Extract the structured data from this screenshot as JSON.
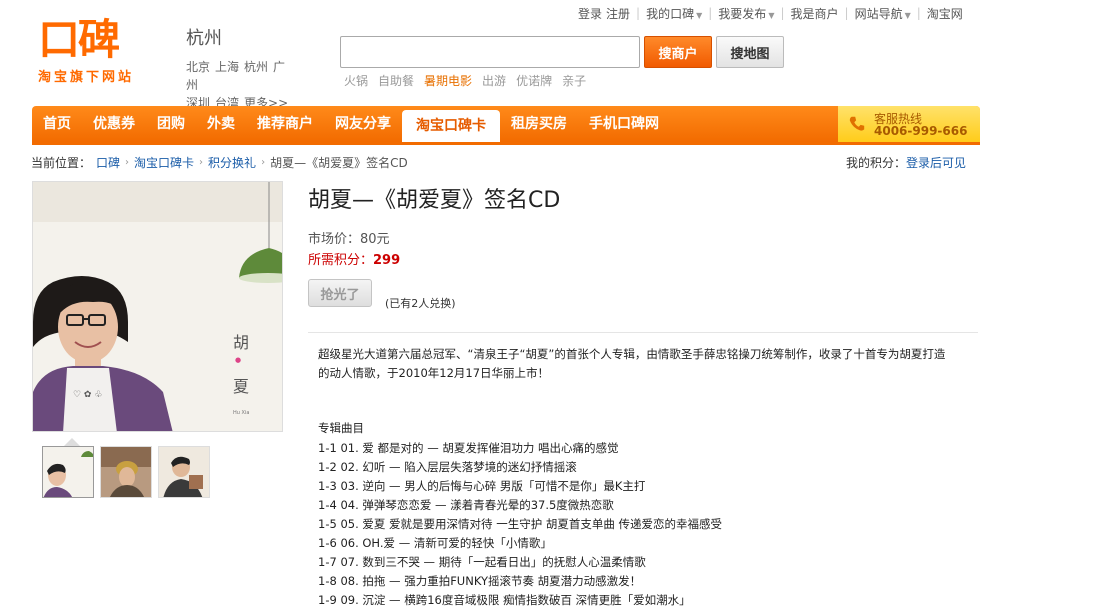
{
  "topbar": {
    "login": "登录",
    "register": "注册",
    "my_koubei": "我的口碑",
    "publish": "我要发布",
    "merchant": "我是商户",
    "site_nav": "网站导航",
    "taobao": "淘宝网"
  },
  "logo": {
    "main": "口碑",
    "sub": "淘宝旗下网站"
  },
  "city": {
    "current": "杭州",
    "row1": [
      "北京",
      "上海",
      "杭州",
      "广州"
    ],
    "row2": [
      "深圳",
      "台湾",
      "更多>>"
    ]
  },
  "search": {
    "value": "",
    "btn_merchant": "搜商户",
    "btn_map": "搜地图",
    "hot": [
      "火锅",
      "自助餐",
      "暑期电影",
      "出游",
      "优诺牌",
      "亲子"
    ]
  },
  "nav": {
    "items": [
      "首页",
      "优惠券",
      "团购",
      "外卖",
      "推荐商户",
      "网友分享",
      "淘宝口碑卡",
      "租房买房",
      "手机口碑网"
    ],
    "active_index": 6,
    "hotline_label": "客服热线",
    "hotline_number": "4006-999-666"
  },
  "breadcrumb": {
    "prefix": "当前位置：",
    "items": [
      "口碑",
      "淘宝口碑卡",
      "积分换礼"
    ],
    "current": "胡夏—《胡爱夏》签名CD"
  },
  "mypoints": {
    "label": "我的积分：",
    "link": "登录后可见"
  },
  "image": {
    "cover_text_1": "胡",
    "cover_text_2": "夏",
    "cover_small": "Hu Xia"
  },
  "product": {
    "title": "胡夏—《胡爱夏》签名CD",
    "price_label": "市场价：",
    "price_value": "80元",
    "points_label": "所需积分：",
    "points_value": "299",
    "soldout_btn": "抢光了",
    "exchanged": "(已有2人兑换)"
  },
  "description": {
    "text": "超级星光大道第六届总冠军、“清泉王子“胡夏”的首张个人专辑，由情歌圣手薛忠铭操刀统筹制作，收录了十首专为胡夏打造的动人情歌，于2010年12月17日华丽上市！",
    "tracks_heading": "专辑曲目",
    "tracks": [
      "1-1 01. 爱 都是对的 — 胡夏发挥催泪功力 唱出心痛的感觉",
      "1-2 02. 幻听 — 陷入层层失落梦境的迷幻抒情摇滚",
      "1-3 03. 逆向 — 男人的后悔与心碎 男版「可惜不是你」最K主打",
      "1-4 04. 弹弹琴恋恋爱 — 漾着青春光晕的37.5度微热恋歌",
      "1-5 05. 爱夏 爱就是要用深情对待 一生守护 胡夏首支单曲 传递爱恋的幸福感受",
      "1-6 06. OH.爱 — 清新可爱的轻快「小情歌」",
      "1-7 07. 数到三不哭 — 期待「一起看日出」的抚慰人心温柔情歌",
      "1-8 08. 拍拖 — 强力重拍FUNKY摇滚节奏 胡夏潜力动感激发！",
      "1-9 09. 沉淀 — 横跨16度音域极限 痴情指数破百 深情更胜「爱如潮水」"
    ]
  },
  "colors": {
    "brand_orange": "#f26b00",
    "link_blue": "#1a5ca8",
    "points_red": "#cc0000"
  }
}
